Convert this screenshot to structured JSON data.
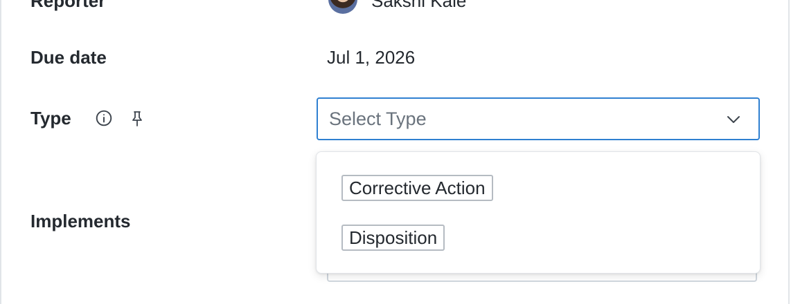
{
  "fields": {
    "reporter": {
      "label": "Reporter",
      "value": "Sakshi Kale"
    },
    "due_date": {
      "label": "Due date",
      "value": "Jul 1, 2026"
    },
    "type": {
      "label": "Type",
      "placeholder": "Select Type",
      "options": [
        "Corrective Action",
        "Disposition"
      ]
    },
    "implements": {
      "label": "Implements"
    }
  },
  "icons": {
    "info": "info-icon",
    "pin": "pin-icon",
    "chevron": "chevron-down-icon"
  },
  "colors": {
    "focus_border": "#2f80d1",
    "placeholder": "#6a737d",
    "text": "#24292f"
  }
}
